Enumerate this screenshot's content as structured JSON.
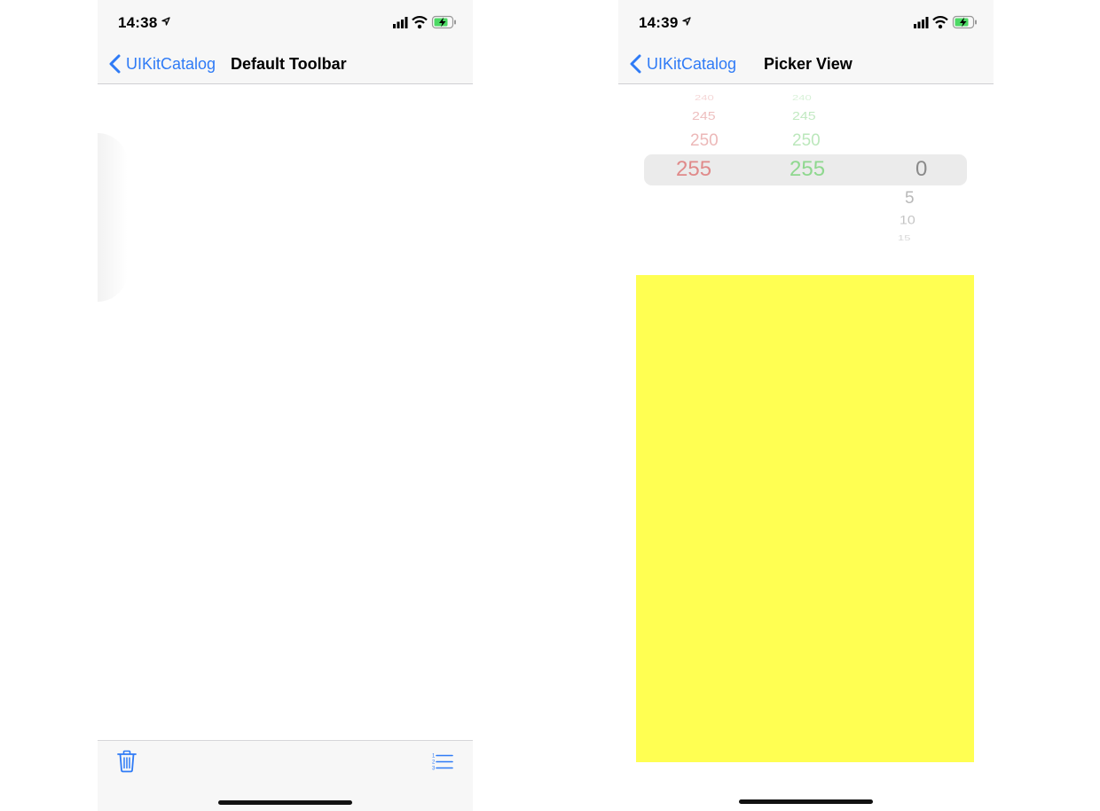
{
  "left": {
    "status": {
      "time": "14:38"
    },
    "nav": {
      "back_label": "UIKitCatalog",
      "title": "Default Toolbar"
    },
    "toolbar": {
      "left_icon": "trash-icon",
      "right_icon": "numbered-list-icon"
    }
  },
  "right": {
    "status": {
      "time": "14:39"
    },
    "nav": {
      "back_label": "UIKitCatalog",
      "title": "Picker View"
    },
    "picker": {
      "columns": [
        {
          "name": "red",
          "color": "#e08a8a",
          "above": [
            "240",
            "245",
            "250"
          ],
          "selected": "255",
          "below": []
        },
        {
          "name": "green",
          "color": "#8fd88f",
          "above": [
            "240",
            "245",
            "250"
          ],
          "selected": "255",
          "below": []
        },
        {
          "name": "blue",
          "color": "#8a8a8a",
          "above": [],
          "selected": "0",
          "below": [
            "5",
            "10",
            "15"
          ]
        }
      ]
    },
    "swatch_color": "#ffff52"
  },
  "colors": {
    "accent": "#2f7bf6",
    "bar_background": "#f7f7f7"
  }
}
